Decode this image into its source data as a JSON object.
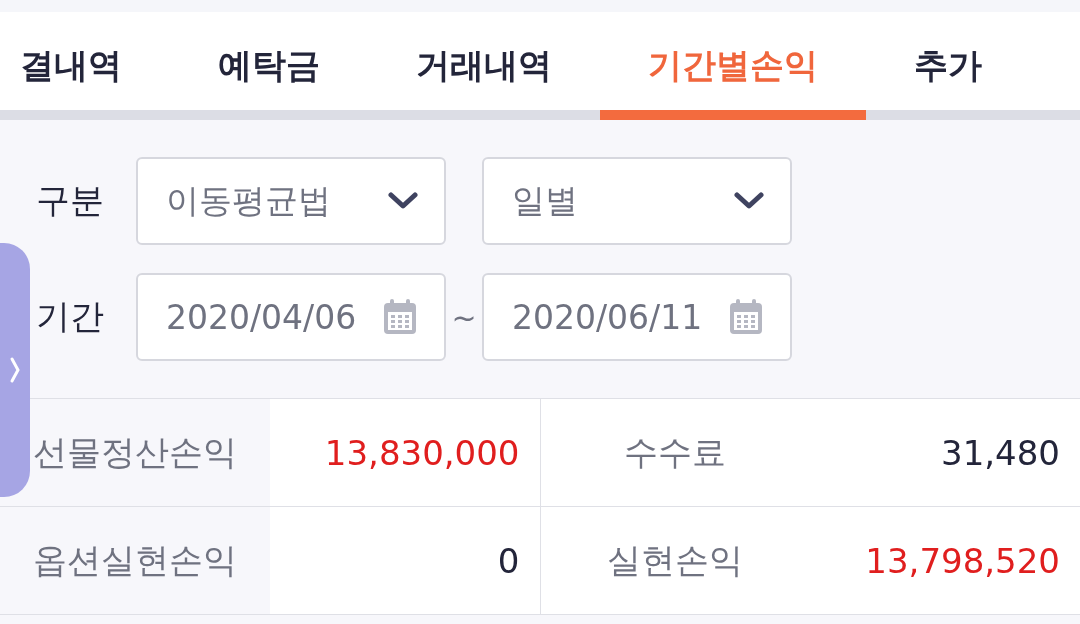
{
  "tabs": [
    {
      "label": "결내역",
      "selected": false
    },
    {
      "label": "예탁금",
      "selected": false
    },
    {
      "label": "거래내역",
      "selected": false
    },
    {
      "label": "기간별손익",
      "selected": true
    },
    {
      "label": "추가",
      "selected": false
    }
  ],
  "filters": {
    "category_label": "구분",
    "method": {
      "value": "이동평균법"
    },
    "interval": {
      "value": "일별"
    },
    "period_label": "기간",
    "start_date": {
      "value": "2020/04/06"
    },
    "separator": "~",
    "end_date": {
      "value": "2020/06/11"
    }
  },
  "summary": [
    {
      "label": "선물정산손익",
      "value": "13,830,000",
      "positive": true
    },
    {
      "label": "수수료",
      "value": "31,480",
      "positive": false
    },
    {
      "label": "옵션실현손익",
      "value": "0",
      "positive": false
    },
    {
      "label": "실현손익",
      "value": "13,798,520",
      "positive": true
    }
  ]
}
